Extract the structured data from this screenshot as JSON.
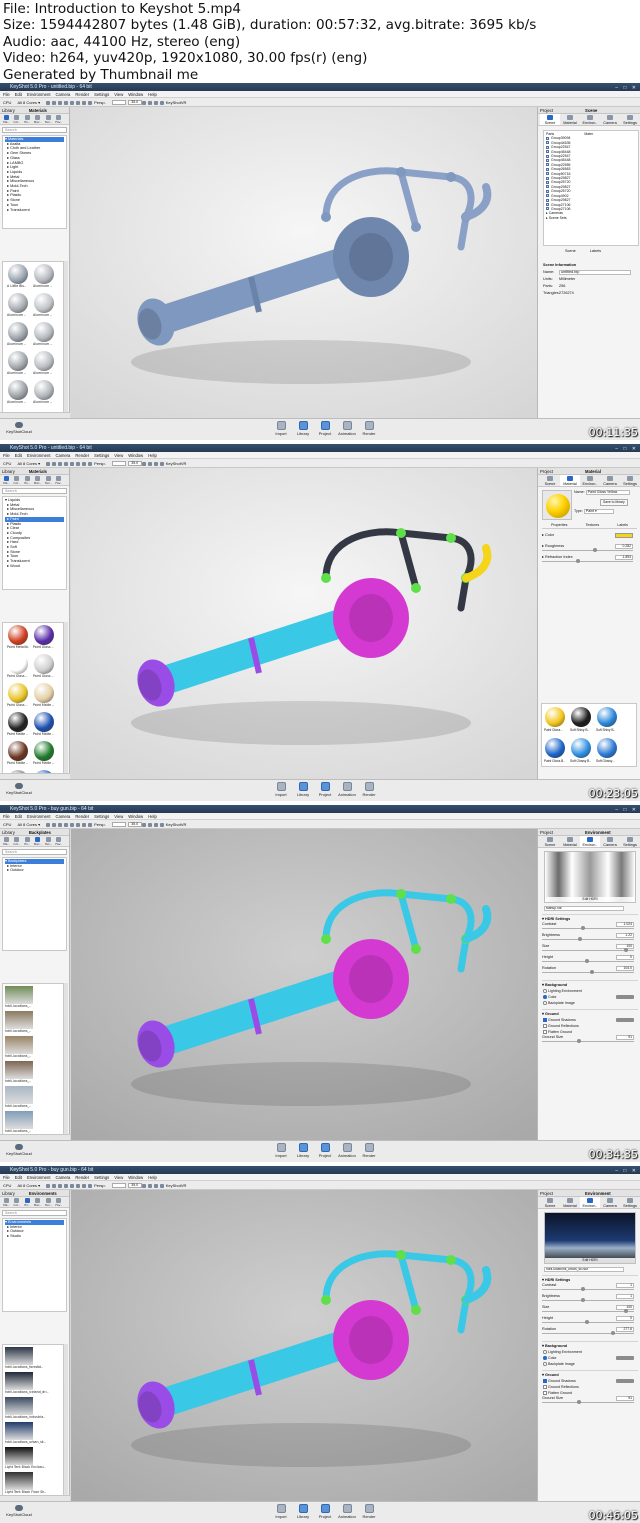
{
  "info": {
    "file": "File: Introduction to Keyshot 5.mp4",
    "size": "Size: 1594442807 bytes (1.48 GiB), duration: 00:57:32, avg.bitrate: 3695 kb/s",
    "audio": "Audio: aac, 44100 Hz, stereo (eng)",
    "video": "Video: h264, yuv420p, 1920x1080, 30.00 fps(r) (eng)",
    "generated": "Generated by Thumbnail me"
  },
  "menus": [
    "File",
    "Edit",
    "Environment",
    "Camera",
    "Render",
    "Settings",
    "View",
    "Window",
    "Help"
  ],
  "toolbar": {
    "cpu": "CPU",
    "cores": "All 8 Cores",
    "persp": "Persp.",
    "persp_value": "35.0",
    "keyshotvr": "KeyShotVR"
  },
  "library_tabs": [
    "Ma..",
    "Col..",
    "En..",
    "Bac..",
    "Tex..",
    "Fav.."
  ],
  "search_placeholder": "Search",
  "bottom": {
    "cloud": "KeyShotCloud",
    "buttons": [
      "Import",
      "Library",
      "Project",
      "Animation",
      "Render"
    ]
  },
  "frames": [
    {
      "title": "KeyShot 5.0 Pro - untitled.bip - 64 bit",
      "library_title": "Materials",
      "tree": [
        "Materials",
        "Axalta",
        "Cloth and Leather",
        "Gem Stones",
        "Glass",
        "LAMBO",
        "Light",
        "Liquids",
        "Metal",
        "Miscellaneous",
        "Mold-Tech",
        "Paint",
        "Plastic",
        "Stone",
        "Toon",
        "Translucent"
      ],
      "tree_selected": 0,
      "grid_captions": [
        "A Little Blu..",
        "Aluminum ..",
        "Aluminum ..",
        "Aluminum ..",
        "Aluminum ..",
        "Aluminum ..",
        "Aluminum ..",
        "Aluminum ..",
        "Aluminum ..",
        "Aluminum .."
      ],
      "project_title": "Scene",
      "project_tabs": [
        "Scene",
        "Material",
        "Environ..",
        "Camera",
        "Settings"
      ],
      "timestamp": "00:11:35",
      "scene": {
        "header": [
          "Parts",
          "Mater"
        ],
        "parts": [
          "Group39094",
          "Group44635",
          "Group22547",
          "Group45448",
          "Group22547",
          "Group45448",
          "Group22555",
          "Group26563",
          "Group90716",
          "Group29827",
          "Group25720",
          "Group29827",
          "Group25720",
          "Group4902",
          "Group29827",
          "Group27106",
          "Group27106"
        ],
        "groups": [
          "Cameras",
          "Scene Sets"
        ],
        "tabs": [
          "Scene",
          "Labels"
        ],
        "info_title": "Scene Information",
        "info": [
          {
            "k": "Name:",
            "v": "untitled.bip"
          },
          {
            "k": "Units:",
            "v": "Millimeter"
          },
          {
            "k": "Parts:",
            "v": "256"
          },
          {
            "k": "Triangles:",
            "v": "2726274"
          }
        ]
      }
    },
    {
      "title": "KeyShot 5.0 Pro - untitled.bip - 64 bit",
      "library_title": "Materials",
      "tree": [
        "Liquids",
        "Metal",
        "Miscellaneous",
        "Mold-Tech",
        "Paint",
        "Plastic",
        "Clear",
        "Cloudy",
        "Composites",
        "Hard",
        "Soft",
        "Stone",
        "Toon",
        "Translucent",
        "Wood"
      ],
      "tree_selected": 4,
      "grid_captions": [
        "Paint Metallic..",
        "Paint Gloss ..",
        "Paint Gloss ..",
        "Paint Gloss ..",
        "Paint Gloss ..",
        "Paint Matte ..",
        "Paint Matte ..",
        "Paint Matte ..",
        "Paint Matte ..",
        "Paint Matte ..",
        "Paint Matte ..",
        "Paint Matte .."
      ],
      "project_title": "Material",
      "project_tabs": [
        "Scene",
        "Material",
        "Environ..",
        "Camera",
        "Settings"
      ],
      "timestamp": "00:23:05",
      "material": {
        "name_label": "Name:",
        "name": "Paint Gloss Yellow",
        "save_btn": "Save to library",
        "type_label": "Type:",
        "type": "Paint",
        "tabs": [
          "Properties",
          "Textures",
          "Labels"
        ],
        "props": [
          {
            "label": "Color",
            "value": ""
          },
          {
            "label": "Roughness",
            "value": "0.282"
          },
          {
            "label": "Refraction Index",
            "value": "1.893"
          }
        ],
        "swatches": [
          "Paint Gloss ..",
          "Soft Shiny B..",
          "Soft Shiny B..",
          "Paint Gloss B..",
          "Soft Glossy B..",
          "Soft Glossy .."
        ]
      }
    },
    {
      "title": "KeyShot 5.0 Pro - buy gun.bip - 64 bit",
      "library_title": "Backplates",
      "tree": [
        "Backplates",
        "Interior",
        "Outdoor"
      ],
      "tree_selected": 0,
      "grid_captions": [
        "hdrli-locations_..",
        "hdrli-locations_..",
        "hdrli-locations_..",
        "hdrli-locations_..",
        "hdrli-locations_..",
        "hdrli-locations_.."
      ],
      "project_title": "Environment",
      "project_tabs": [
        "Scene",
        "Material",
        "Environ..",
        "Camera",
        "Settings"
      ],
      "timestamp": "00:34:35",
      "environment": {
        "hdri_name": "startup.hdr",
        "edit_btn": "Edit HDRI",
        "hdri_settings": "HDRI Settings",
        "sliders": [
          {
            "label": "Contrast",
            "value": "1.024"
          },
          {
            "label": "Brightness",
            "value": "1.22"
          },
          {
            "label": "Size",
            "value": "100"
          },
          {
            "label": "Height",
            "value": "0"
          },
          {
            "label": "Rotation",
            "value": "104.0"
          }
        ],
        "background": "Background",
        "bg_options": [
          "Lighting Environment",
          "Color",
          "Backplate Image"
        ],
        "bg_selected": 1,
        "ground": "Ground",
        "ground_options": [
          "Ground Shadows",
          "Ground Reflections",
          "Flatten Ground"
        ],
        "ground_checked": [
          true,
          false,
          false
        ],
        "ground_size_label": "Ground Size",
        "ground_size": "91"
      }
    },
    {
      "title": "KeyShot 5.0 Pro - buy gun.bip - 64 bit",
      "library_title": "Environments",
      "tree": [
        "Environments",
        "Interior",
        "Outdoor",
        "Studio"
      ],
      "tree_selected": 0,
      "grid_captions": [
        "hdrli-locations_forestbi..",
        "hdrli-locations_iceland_dri..",
        "hdrli-locations_industria..",
        "hdrli-locations_urban_sk..",
        "Light Tent Black Enclosu..",
        "Light Tent Black Floor Sh.."
      ],
      "project_title": "Environment",
      "project_tabs": [
        "Scene",
        "Material",
        "Environ..",
        "Camera",
        "Settings"
      ],
      "timestamp": "00:46:05",
      "environment": {
        "hdri_name": "hdrli-locations_urban_sk.hdz",
        "edit_btn": "Edit HDRI",
        "hdri_settings": "HDRI Settings",
        "sliders": [
          {
            "label": "Contrast",
            "value": "1"
          },
          {
            "label": "Brightness",
            "value": "1"
          },
          {
            "label": "Size",
            "value": "100"
          },
          {
            "label": "Height",
            "value": "0"
          },
          {
            "label": "Rotation",
            "value": "277.6"
          }
        ],
        "background": "Background",
        "bg_options": [
          "Lighting Environment",
          "Color",
          "Backplate Image"
        ],
        "bg_selected": 1,
        "ground": "Ground",
        "ground_options": [
          "Ground Shadows",
          "Ground Reflections",
          "Flatten Ground"
        ],
        "ground_checked": [
          true,
          false,
          false
        ],
        "ground_size_label": "Ground Size",
        "ground_size": "91"
      }
    }
  ],
  "colors": {
    "gun_blue": "#7f98bf",
    "paint_cyan": "#39c8e6",
    "paint_magenta": "#d43ad2",
    "paint_purple": "#9a4de6",
    "paint_green": "#5fe04a",
    "paint_yellow": "#f5d51a"
  }
}
